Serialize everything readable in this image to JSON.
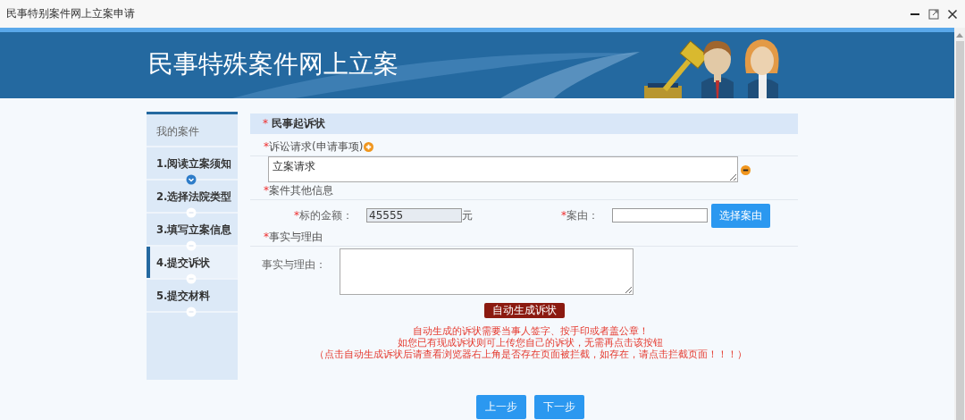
{
  "window": {
    "title": "民事特别案件网上立案申请"
  },
  "banner": {
    "title": "民事特殊案件网上立案"
  },
  "sidebar": {
    "heading": "我的案件",
    "steps": [
      {
        "label": "1.阅读立案须知",
        "selected": false,
        "completed": true
      },
      {
        "label": "2.选择法院类型",
        "selected": false,
        "completed": false
      },
      {
        "label": "3.填写立案信息",
        "selected": false,
        "completed": false
      },
      {
        "label": "4.提交诉状",
        "selected": true,
        "completed": false
      },
      {
        "label": "5.提交材料",
        "selected": false,
        "completed": false
      }
    ]
  },
  "form": {
    "section": {
      "mark": "*",
      "title": "民事起诉状"
    },
    "claims": {
      "mark": "*",
      "label": "诉讼请求(申请事项)",
      "value": "立案请求"
    },
    "other_info": {
      "mark": "*",
      "label": "案件其他信息"
    },
    "amount": {
      "mark": "*",
      "label": "标的金额：",
      "value": "45555",
      "unit": "元"
    },
    "cause": {
      "mark": "*",
      "label": "案由：",
      "button": "选择案由"
    },
    "facts": {
      "mark": "*",
      "label": "事实与理由",
      "field_label": "事实与理由："
    },
    "generate_button": "自动生成诉状",
    "notices": [
      "自动生成的诉状需要当事人签字、按手印或者盖公章！",
      "如您已有现成诉状则可上传您自己的诉状，无需再点击该按钮",
      "（点击自动生成诉状后请查看浏览器右上角是否存在页面被拦截，如存在，请点击拦截页面！！！）"
    ],
    "nav_buttons": [
      "上一步",
      "下一步"
    ]
  }
}
